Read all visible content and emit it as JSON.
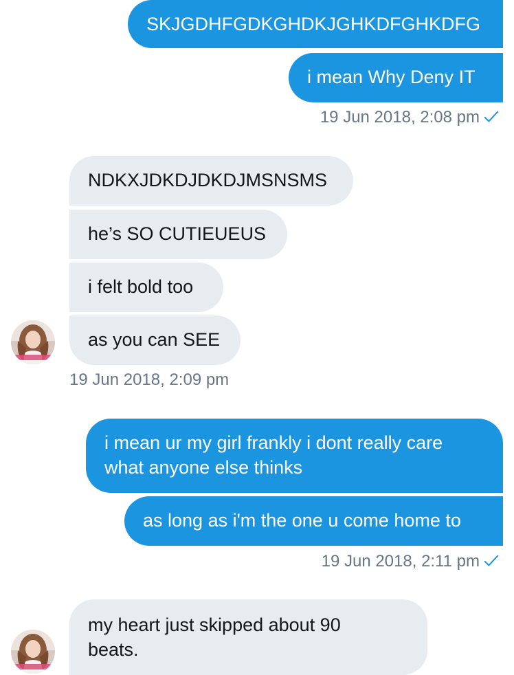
{
  "conversation": {
    "messages": [
      {
        "id": "m1",
        "direction": "outgoing",
        "text": "SKJGDHFGDKGHDKJGHKDFGHKDFG"
      },
      {
        "id": "m2",
        "direction": "outgoing",
        "text": "i mean Why Deny IT"
      },
      {
        "id": "m3",
        "direction": "incoming",
        "text": "NDKXJDKDJDKDJMSNSMS"
      },
      {
        "id": "m4",
        "direction": "incoming",
        "text": "he’s SO CUTIEUEUS"
      },
      {
        "id": "m5",
        "direction": "incoming",
        "text": "i felt bold too"
      },
      {
        "id": "m6",
        "direction": "incoming",
        "text": "as you can SEE"
      },
      {
        "id": "m7",
        "direction": "outgoing",
        "text": "i mean ur my girl frankly i dont really care what anyone else thinks"
      },
      {
        "id": "m8",
        "direction": "outgoing",
        "text": "as long as i'm the one u come home to"
      },
      {
        "id": "m9",
        "direction": "incoming",
        "text": "my heart just skipped about 90 beats."
      }
    ],
    "timestamps": [
      {
        "text": "19 Jun 2018, 2:08 pm",
        "read_receipt": true
      },
      {
        "text": "19 Jun 2018, 2:09 pm",
        "read_receipt": false
      },
      {
        "text": "19 Jun 2018, 2:11 pm",
        "read_receipt": true
      }
    ]
  },
  "colors": {
    "outgoing_bubble": "#1b95e0",
    "incoming_bubble": "#e6ecf0",
    "timestamp_text": "#657786",
    "read_check": "#1b95e0"
  },
  "icons": {
    "read_receipt": "checkmark-icon",
    "avatar": "user-avatar-photo"
  }
}
